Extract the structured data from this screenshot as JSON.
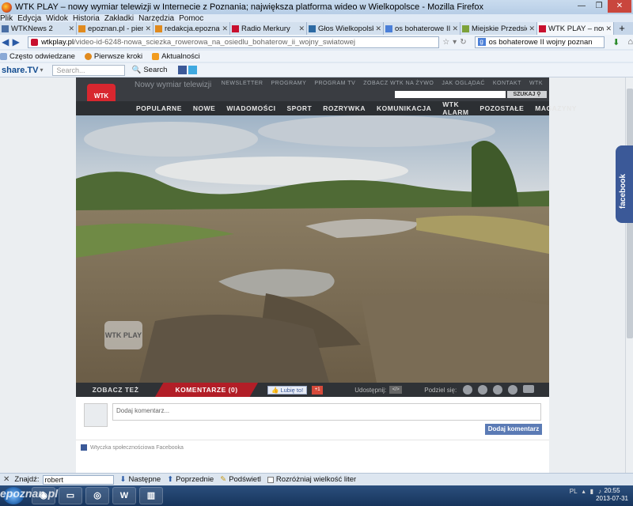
{
  "window": {
    "title": "WTK PLAY – nowy wymiar telewizji w Internecie z Poznania; największa platforma wideo w Wielkopolsce - Mozilla Firefox"
  },
  "menu": [
    "Plik",
    "Edycja",
    "Widok",
    "Historia",
    "Zakładki",
    "Narzędzia",
    "Pomoc"
  ],
  "tabs": [
    {
      "label": "WTKNews 2",
      "color": "#4a6fa5"
    },
    {
      "label": "epoznan.pl - pierws...",
      "color": "#e08a1e"
    },
    {
      "label": "redakcja.epoznan.pl",
      "color": "#e08a1e"
    },
    {
      "label": "Radio Merkury",
      "color": "#c8102e"
    },
    {
      "label": "Głos Wielkopolski - ...",
      "color": "#2d6aa3"
    },
    {
      "label": "os bohaterowe II w...",
      "color": "#4a7fd8"
    },
    {
      "label": "Miejskie Przedsiębi...",
      "color": "#7da23a"
    },
    {
      "label": "WTK PLAY – nowy ...",
      "color": "#c8102e"
    }
  ],
  "nav": {
    "url_host": "wtkplay.pl",
    "url_path": "/video-id-6248-nowa_sciezka_rowerowa_na_osiedlu_bohaterow_ii_wojny_swiatowej",
    "search_value": "os bohaterowe II wojny poznan"
  },
  "bookmarks": [
    "Często odwiedzane",
    "Pierwsze kroki",
    "Aktualności"
  ],
  "sharetv": {
    "logo": "share.TV",
    "search_placeholder": "Search...",
    "search_label": "Search"
  },
  "site": {
    "slogan": "Nowy wymiar telewizji",
    "logo": "WTK PLAY",
    "topnav": [
      "NEWSLETTER",
      "PROGRAMY",
      "PROGRAM TV",
      "ZOBACZ WTK NA ŻYWO",
      "JAK OGLĄDAĆ",
      "KONTAKT",
      "WTK"
    ],
    "search_button": "SZUKAJ",
    "mainnav": [
      "POPULARNE",
      "NOWE",
      "WIADOMOŚCI",
      "SPORT",
      "ROZRYWKA",
      "KOMUNIKACJA",
      "WTK ALARM",
      "POZOSTAŁE",
      "MAGAZYNY"
    ],
    "watermark": "WTK PLAY"
  },
  "video_tabs": {
    "zobacz": "ZOBACZ TEŻ",
    "komentarze": "KOMENTARZE (0)",
    "like": "Lubię to!",
    "gplus": "+1",
    "udostepnij": "Udostępnij:",
    "embed": "</>",
    "podziel": "Podziel się:"
  },
  "comments": {
    "placeholder": "Dodaj komentarz...",
    "button": "Dodaj komentarz",
    "fb_plugin": "Wtyczka społecznościowa Facebooka"
  },
  "facebook_tab": "facebook",
  "findbar": {
    "label": "Znajdź:",
    "value": "robert",
    "next": "Następne",
    "prev": "Poprzednie",
    "highlight": "Podświetl",
    "match_case": "Rozróżniaj wielkość liter"
  },
  "taskbar": {
    "watermark": "epoznan.pl",
    "lang": "PL",
    "time": "20:55",
    "date": "2013-07-31"
  },
  "colors": {
    "brand_red": "#b21e27",
    "header_dark": "#3a3d42",
    "facebook": "#3b5998"
  }
}
